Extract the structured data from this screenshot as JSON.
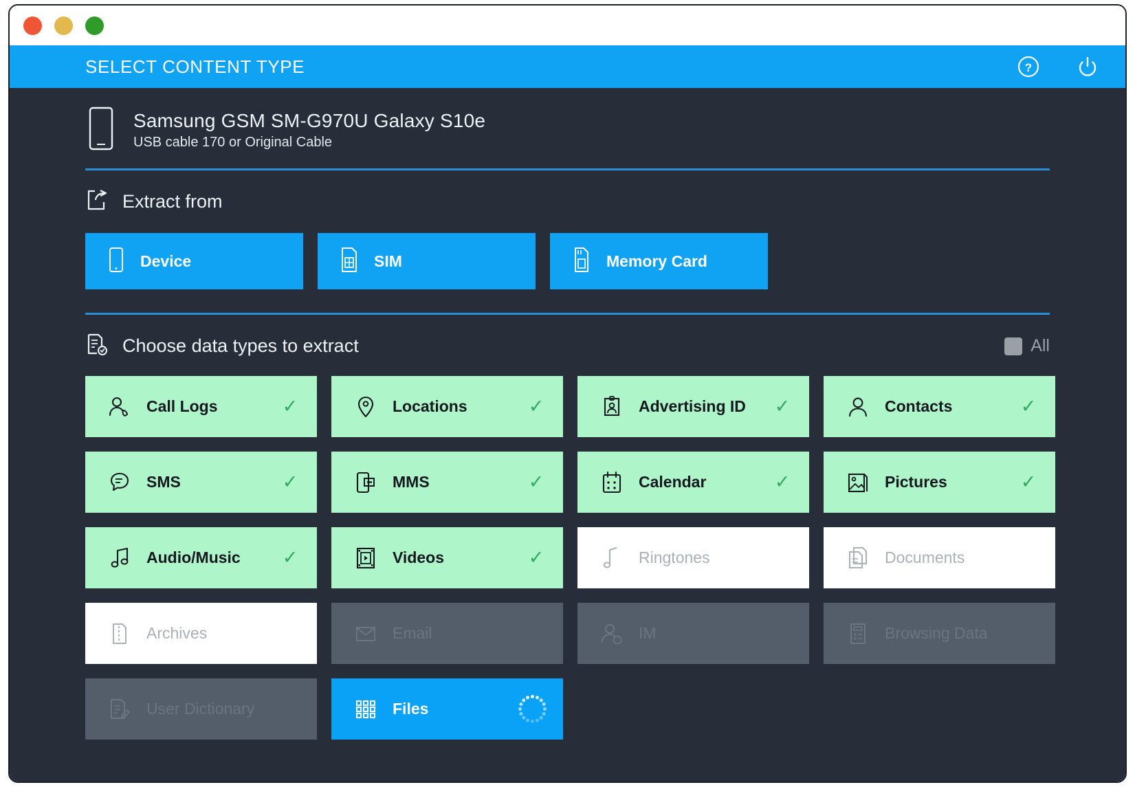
{
  "window": {
    "traffic_lights": [
      "close-red",
      "minimize-yellow",
      "maximize-green"
    ]
  },
  "header": {
    "title": "SELECT CONTENT TYPE",
    "actions": [
      {
        "name": "help-icon",
        "label": "?"
      },
      {
        "name": "power-icon",
        "label": ""
      }
    ],
    "background_color": "#11a3f3"
  },
  "device": {
    "icon": "phone-icon",
    "name": "Samsung GSM SM-G970U Galaxy S10e",
    "connection": "USB cable 170 or Original Cable"
  },
  "extract_from": {
    "icon": "extract-icon",
    "title": "Extract from",
    "sources": [
      {
        "label": "Device",
        "icon": "phone-icon",
        "state": "active"
      },
      {
        "label": "SIM",
        "icon": "sim-card-icon",
        "state": "active"
      },
      {
        "label": "Memory Card",
        "icon": "memory-card-icon",
        "state": "active"
      }
    ]
  },
  "data_types": {
    "icon": "document-check-icon",
    "title": "Choose data types to extract",
    "all_toggle": {
      "label": "All",
      "state": "partial"
    },
    "check_glyph": "✓",
    "tiles": [
      {
        "label": "Call Logs",
        "icon": "call-log-icon",
        "state": "selected"
      },
      {
        "label": "Locations",
        "icon": "location-pin-icon",
        "state": "selected"
      },
      {
        "label": "Advertising ID",
        "icon": "advertising-id-icon",
        "state": "selected"
      },
      {
        "label": "Contacts",
        "icon": "contacts-icon",
        "state": "selected"
      },
      {
        "label": "SMS",
        "icon": "sms-icon",
        "state": "selected"
      },
      {
        "label": "MMS",
        "icon": "mms-icon",
        "state": "selected"
      },
      {
        "label": "Calendar",
        "icon": "calendar-icon",
        "state": "selected"
      },
      {
        "label": "Pictures",
        "icon": "pictures-icon",
        "state": "selected"
      },
      {
        "label": "Audio/Music",
        "icon": "audio-music-icon",
        "state": "selected"
      },
      {
        "label": "Videos",
        "icon": "video-icon",
        "state": "selected"
      },
      {
        "label": "Ringtones",
        "icon": "ringtone-icon",
        "state": "available"
      },
      {
        "label": "Documents",
        "icon": "documents-icon",
        "state": "available"
      },
      {
        "label": "Archives",
        "icon": "archive-icon",
        "state": "available"
      },
      {
        "label": "Email",
        "icon": "email-icon",
        "state": "disabled"
      },
      {
        "label": "IM",
        "icon": "im-icon",
        "state": "disabled"
      },
      {
        "label": "Browsing Data",
        "icon": "browsing-data-icon",
        "state": "disabled"
      },
      {
        "label": "User Dictionary",
        "icon": "user-dictionary-icon",
        "state": "disabled"
      },
      {
        "label": "Files",
        "icon": "files-grid-icon",
        "state": "loading"
      }
    ]
  },
  "colors": {
    "accent_blue": "#11a3f3",
    "selected_green": "#aef5c9",
    "check_green": "#2faa5e",
    "background_dark": "#272e39",
    "disabled_gray": "#545d6a",
    "divider_blue": "#2b8fd4"
  }
}
